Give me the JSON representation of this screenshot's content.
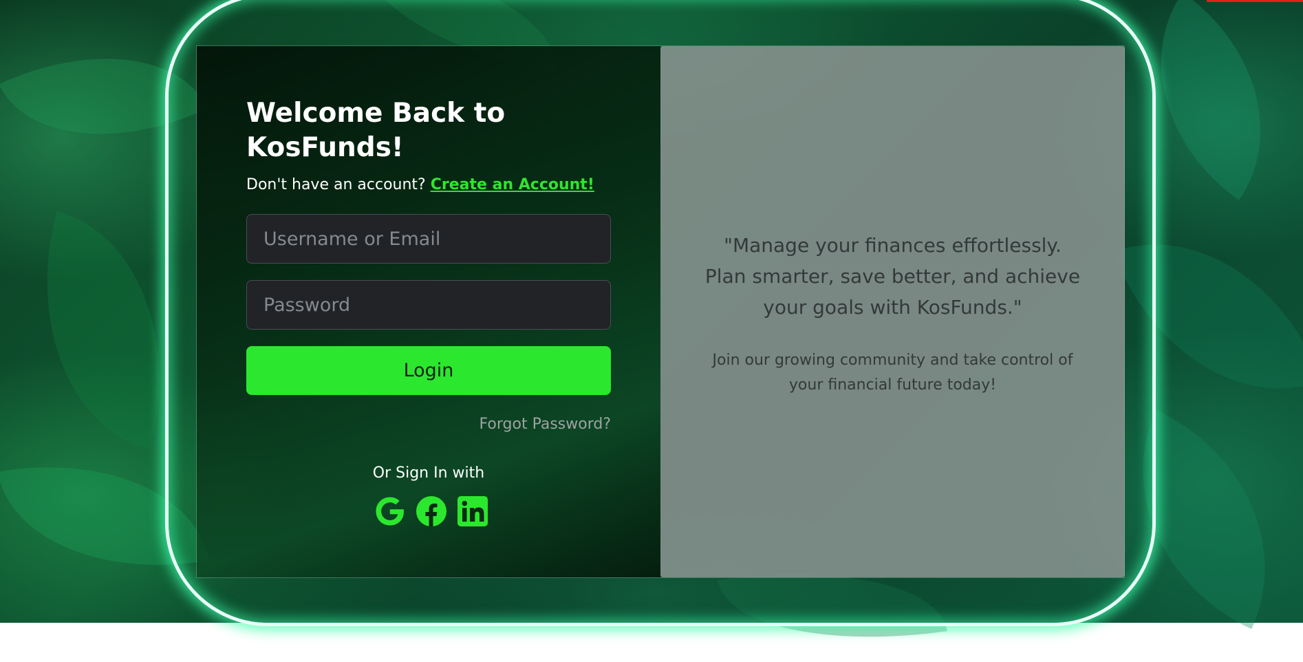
{
  "login": {
    "title": "Welcome Back to KosFunds!",
    "signup_prompt": "Don't have an account?",
    "signup_link": "Create an Account!",
    "username_placeholder": "Username or Email",
    "password_placeholder": "Password",
    "login_label": "Login",
    "forgot_label": "Forgot Password?",
    "or_sign_in": "Or Sign In with",
    "social": [
      {
        "icon": "google-icon",
        "color": "#2be82e"
      },
      {
        "icon": "facebook-icon",
        "color": "#2be82e"
      },
      {
        "icon": "linkedin-icon",
        "color": "#2be82e"
      }
    ]
  },
  "promo": {
    "quote": "\"Manage your finances effortlessly. Plan smarter, save better, and achieve your goals with KosFunds.\"",
    "subtext": "Join our growing community and take control of your financial future today!"
  },
  "colors": {
    "accent": "#2be82e",
    "neon": "#3cffaa",
    "panel_right": "#8c9492"
  }
}
